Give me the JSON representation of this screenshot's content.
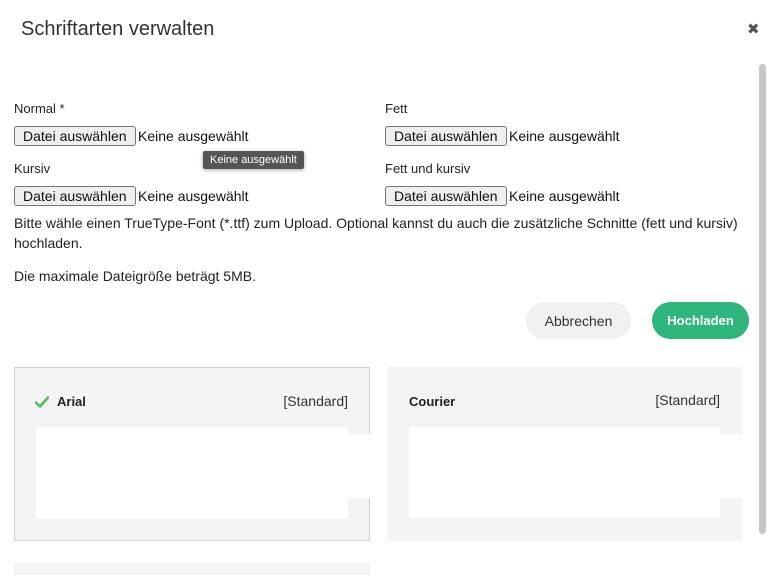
{
  "dialog": {
    "title": "Schriftarten verwalten",
    "close_icon": "close-icon"
  },
  "upload": {
    "button_label": "Datei auswählen",
    "no_file_text": "Keine ausgewählt",
    "fields": [
      {
        "label": "Normal *",
        "file": "Keine ausgewählt"
      },
      {
        "label": "Fett",
        "file": "Keine ausgewählt"
      },
      {
        "label": "Kursiv",
        "file": "Keine ausgewählt"
      },
      {
        "label": "Fett und kursiv",
        "file": "Keine ausgewählt"
      }
    ],
    "tooltip": "Keine ausgewählt"
  },
  "info": {
    "help_text": "Bitte wähle einen TrueType-Font (*.ttf) zum Upload. Optional kannst du auch die zusätzliche Schnitte (fett und kursiv) hochladen.",
    "max_size": "Die maximale Dateigröße beträgt 5MB."
  },
  "actions": {
    "cancel": "Abbrechen",
    "upload": "Hochladen",
    "upload_color": "#2eb67d"
  },
  "fonts": [
    {
      "name": "Arial",
      "tag": "[Standard]",
      "selected": true,
      "icon": "checkmark-icon",
      "check_color": "#5cb85c"
    },
    {
      "name": "Courier",
      "tag": "[Standard]",
      "selected": false
    }
  ]
}
